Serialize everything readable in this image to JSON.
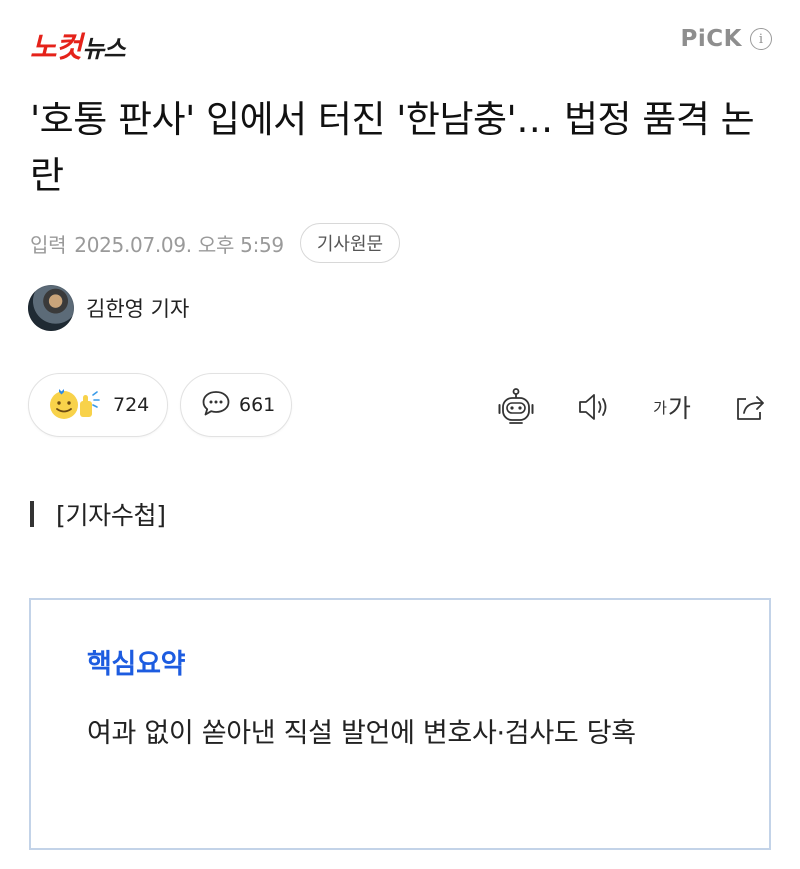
{
  "header": {
    "logo": {
      "part1": "노컷",
      "part2": "뉴스"
    },
    "pick_label": "PiCK",
    "info_icon": "info-icon"
  },
  "article": {
    "title": "'호통 판사' 입에서 터진 '한남충'… 법정 품격 논란",
    "date_label": "입력",
    "date": "2025.07.09. 오후 5:59",
    "source_button": "기사원문",
    "reporter": "김한영 기자",
    "reaction_count": "724",
    "comment_count": "661",
    "font_size_small": "가",
    "font_size_large": "가",
    "section_label": "[기자수첩]"
  },
  "summary": {
    "title": "핵심요약",
    "text": "여과 없이 쏟아낸 직설 발언에 변호사·검사도 당혹"
  },
  "colors": {
    "logo_red": "#e5221a",
    "summary_title_blue": "#1d5ce0",
    "summary_border": "#c3d3e8"
  },
  "icons": [
    "reaction-emoji-icon",
    "comment-bubble-icon",
    "chatbot-icon",
    "speaker-icon",
    "font-size-icon",
    "share-icon",
    "info-icon"
  ]
}
